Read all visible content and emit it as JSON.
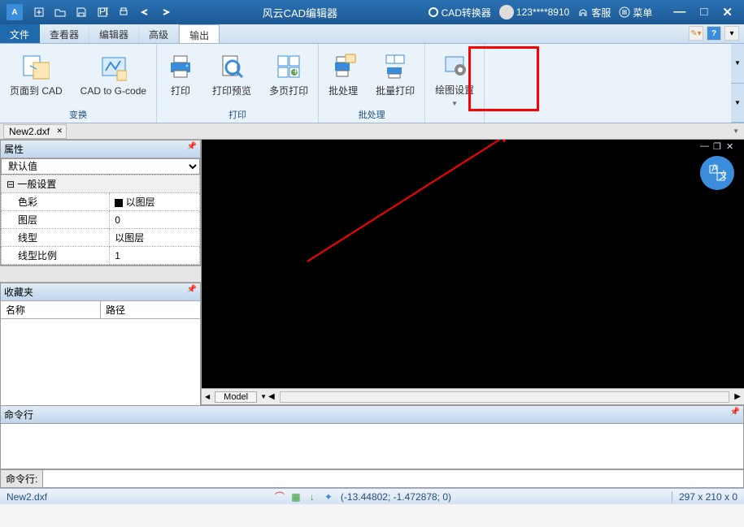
{
  "title": "风云CAD编辑器",
  "titlebar_right": {
    "converter": "CAD转换器",
    "user": "123****8910",
    "support": "客服",
    "menu": "菜单"
  },
  "menu": {
    "items": [
      "文件",
      "查看器",
      "编辑器",
      "高级",
      "输出"
    ],
    "active_index": 4
  },
  "ribbon": {
    "groups": [
      {
        "label": "变换",
        "items": [
          {
            "name": "page-to-cad",
            "label": "页面到 CAD",
            "icon": "page-cad-icon"
          },
          {
            "name": "cad-to-gcode",
            "label": "CAD to G-code",
            "icon": "cad-gcode-icon"
          }
        ]
      },
      {
        "label": "打印",
        "items": [
          {
            "name": "print",
            "label": "打印",
            "icon": "printer-icon"
          },
          {
            "name": "print-preview",
            "label": "打印预览",
            "icon": "magnifier-icon"
          },
          {
            "name": "multipage-print",
            "label": "多页打印",
            "icon": "multipage-icon"
          }
        ]
      },
      {
        "label": "批处理",
        "items": [
          {
            "name": "batch-process",
            "label": "批处理",
            "icon": "batch-icon"
          },
          {
            "name": "batch-print",
            "label": "批量打印",
            "icon": "batch-print-icon",
            "highlighted": true
          }
        ]
      },
      {
        "label": "",
        "items": [
          {
            "name": "draw-settings",
            "label": "绘图设置",
            "icon": "settings-icon",
            "dropdown": true
          }
        ]
      }
    ]
  },
  "doc_tab": {
    "name": "New2.dxf"
  },
  "properties_panel": {
    "title": "属性",
    "select_value": "默认值",
    "section": "一般设置",
    "rows": [
      {
        "label": "色彩",
        "value": "以图层",
        "swatch": "#000"
      },
      {
        "label": "图层",
        "value": "0"
      },
      {
        "label": "线型",
        "value": "以图层"
      },
      {
        "label": "线型比例",
        "value": "1"
      }
    ]
  },
  "favorites_panel": {
    "title": "收藏夹",
    "col1": "名称",
    "col2": "路径"
  },
  "model_tab": "Model",
  "command_panel": {
    "title": "命令行",
    "label": "命令行:"
  },
  "statusbar": {
    "file": "New2.dxf",
    "coords": "(-13.44802; -1.472878; 0)",
    "dims": "297 x 210 x 0"
  }
}
